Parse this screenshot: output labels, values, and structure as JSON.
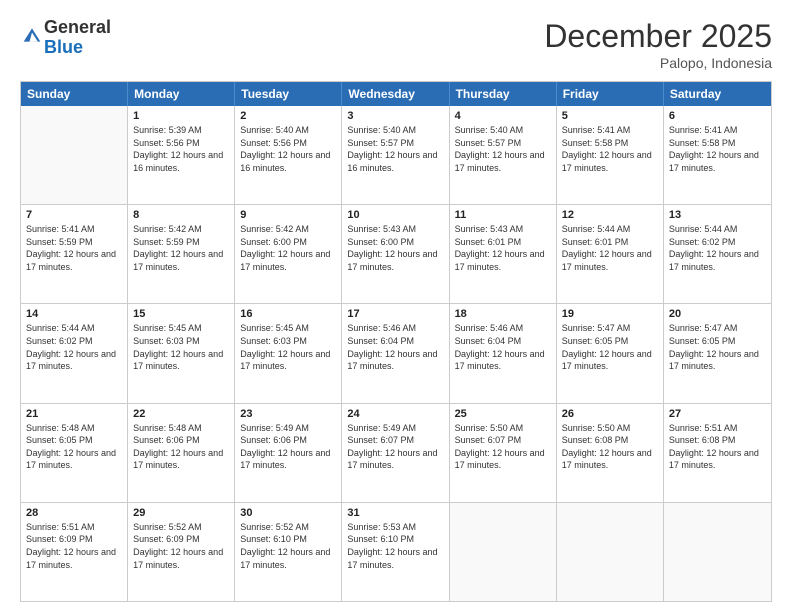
{
  "logo": {
    "general": "General",
    "blue": "Blue"
  },
  "header": {
    "title": "December 2025",
    "location": "Palopo, Indonesia"
  },
  "calendar": {
    "days": [
      "Sunday",
      "Monday",
      "Tuesday",
      "Wednesday",
      "Thursday",
      "Friday",
      "Saturday"
    ],
    "rows": [
      [
        {
          "day": "",
          "empty": true
        },
        {
          "day": "1",
          "sunrise": "5:39 AM",
          "sunset": "5:56 PM",
          "daylight": "12 hours and 16 minutes."
        },
        {
          "day": "2",
          "sunrise": "5:40 AM",
          "sunset": "5:56 PM",
          "daylight": "12 hours and 16 minutes."
        },
        {
          "day": "3",
          "sunrise": "5:40 AM",
          "sunset": "5:57 PM",
          "daylight": "12 hours and 16 minutes."
        },
        {
          "day": "4",
          "sunrise": "5:40 AM",
          "sunset": "5:57 PM",
          "daylight": "12 hours and 17 minutes."
        },
        {
          "day": "5",
          "sunrise": "5:41 AM",
          "sunset": "5:58 PM",
          "daylight": "12 hours and 17 minutes."
        },
        {
          "day": "6",
          "sunrise": "5:41 AM",
          "sunset": "5:58 PM",
          "daylight": "12 hours and 17 minutes."
        }
      ],
      [
        {
          "day": "7",
          "sunrise": "5:41 AM",
          "sunset": "5:59 PM",
          "daylight": "12 hours and 17 minutes."
        },
        {
          "day": "8",
          "sunrise": "5:42 AM",
          "sunset": "5:59 PM",
          "daylight": "12 hours and 17 minutes."
        },
        {
          "day": "9",
          "sunrise": "5:42 AM",
          "sunset": "6:00 PM",
          "daylight": "12 hours and 17 minutes."
        },
        {
          "day": "10",
          "sunrise": "5:43 AM",
          "sunset": "6:00 PM",
          "daylight": "12 hours and 17 minutes."
        },
        {
          "day": "11",
          "sunrise": "5:43 AM",
          "sunset": "6:01 PM",
          "daylight": "12 hours and 17 minutes."
        },
        {
          "day": "12",
          "sunrise": "5:44 AM",
          "sunset": "6:01 PM",
          "daylight": "12 hours and 17 minutes."
        },
        {
          "day": "13",
          "sunrise": "5:44 AM",
          "sunset": "6:02 PM",
          "daylight": "12 hours and 17 minutes."
        }
      ],
      [
        {
          "day": "14",
          "sunrise": "5:44 AM",
          "sunset": "6:02 PM",
          "daylight": "12 hours and 17 minutes."
        },
        {
          "day": "15",
          "sunrise": "5:45 AM",
          "sunset": "6:03 PM",
          "daylight": "12 hours and 17 minutes."
        },
        {
          "day": "16",
          "sunrise": "5:45 AM",
          "sunset": "6:03 PM",
          "daylight": "12 hours and 17 minutes."
        },
        {
          "day": "17",
          "sunrise": "5:46 AM",
          "sunset": "6:04 PM",
          "daylight": "12 hours and 17 minutes."
        },
        {
          "day": "18",
          "sunrise": "5:46 AM",
          "sunset": "6:04 PM",
          "daylight": "12 hours and 17 minutes."
        },
        {
          "day": "19",
          "sunrise": "5:47 AM",
          "sunset": "6:05 PM",
          "daylight": "12 hours and 17 minutes."
        },
        {
          "day": "20",
          "sunrise": "5:47 AM",
          "sunset": "6:05 PM",
          "daylight": "12 hours and 17 minutes."
        }
      ],
      [
        {
          "day": "21",
          "sunrise": "5:48 AM",
          "sunset": "6:05 PM",
          "daylight": "12 hours and 17 minutes."
        },
        {
          "day": "22",
          "sunrise": "5:48 AM",
          "sunset": "6:06 PM",
          "daylight": "12 hours and 17 minutes."
        },
        {
          "day": "23",
          "sunrise": "5:49 AM",
          "sunset": "6:06 PM",
          "daylight": "12 hours and 17 minutes."
        },
        {
          "day": "24",
          "sunrise": "5:49 AM",
          "sunset": "6:07 PM",
          "daylight": "12 hours and 17 minutes."
        },
        {
          "day": "25",
          "sunrise": "5:50 AM",
          "sunset": "6:07 PM",
          "daylight": "12 hours and 17 minutes."
        },
        {
          "day": "26",
          "sunrise": "5:50 AM",
          "sunset": "6:08 PM",
          "daylight": "12 hours and 17 minutes."
        },
        {
          "day": "27",
          "sunrise": "5:51 AM",
          "sunset": "6:08 PM",
          "daylight": "12 hours and 17 minutes."
        }
      ],
      [
        {
          "day": "28",
          "sunrise": "5:51 AM",
          "sunset": "6:09 PM",
          "daylight": "12 hours and 17 minutes."
        },
        {
          "day": "29",
          "sunrise": "5:52 AM",
          "sunset": "6:09 PM",
          "daylight": "12 hours and 17 minutes."
        },
        {
          "day": "30",
          "sunrise": "5:52 AM",
          "sunset": "6:10 PM",
          "daylight": "12 hours and 17 minutes."
        },
        {
          "day": "31",
          "sunrise": "5:53 AM",
          "sunset": "6:10 PM",
          "daylight": "12 hours and 17 minutes."
        },
        {
          "day": "",
          "empty": true
        },
        {
          "day": "",
          "empty": true
        },
        {
          "day": "",
          "empty": true
        }
      ]
    ]
  }
}
